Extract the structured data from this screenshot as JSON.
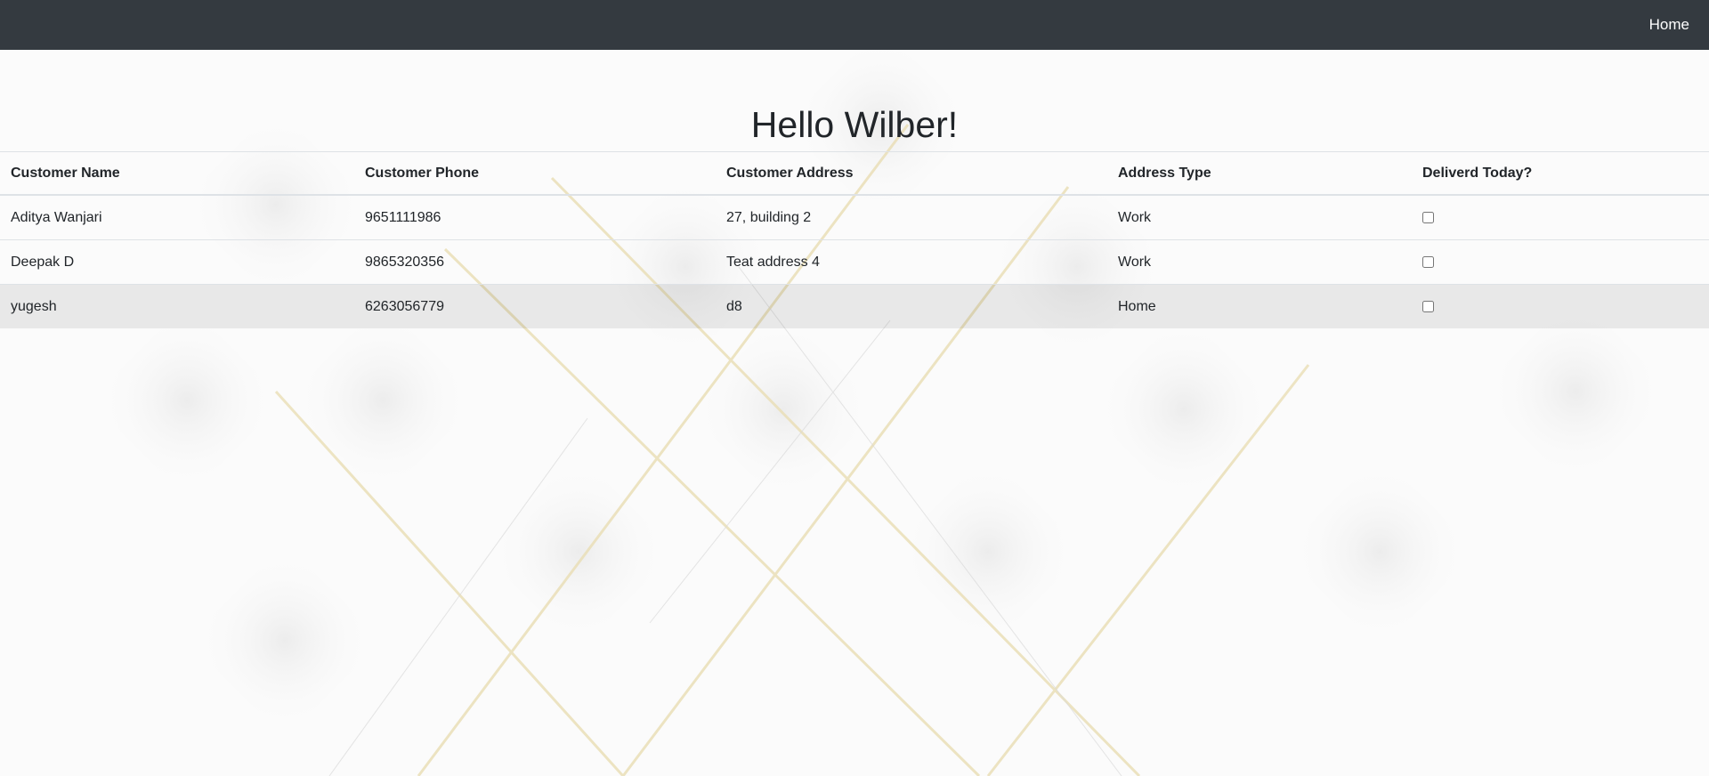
{
  "nav": {
    "home_label": "Home"
  },
  "page": {
    "greeting": "Hello Wilber!"
  },
  "table": {
    "headers": [
      "Customer Name",
      "Customer Phone",
      "Customer Address",
      "Address Type",
      "Deliverd Today?"
    ],
    "rows": [
      {
        "name": "Aditya Wanjari",
        "phone": "9651111986",
        "address": "27, building 2",
        "type": "Work",
        "delivered": false
      },
      {
        "name": "Deepak D",
        "phone": "9865320356",
        "address": "Teat address 4",
        "type": "Work",
        "delivered": false
      },
      {
        "name": "yugesh",
        "phone": "6263056779",
        "address": "d8",
        "type": "Home",
        "delivered": false
      }
    ]
  },
  "colors": {
    "navbar": "#343a40",
    "background": "#fbfbfb",
    "gold_lines": "#e8d9a8"
  }
}
